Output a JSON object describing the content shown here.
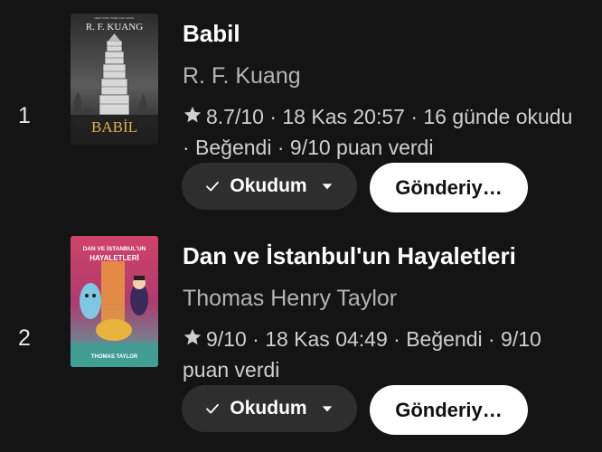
{
  "books": [
    {
      "rank": "1",
      "title": "Babil",
      "author": "R. F. Kuang",
      "meta": "8.7/10 · 18 Kas 20:57 · 16 günde okudu · Beğendi · 9/10 puan verdi",
      "status_label": "Okudum",
      "send_label": "Gönderiy…",
      "cover": {
        "top_text": "R. F. KUANG",
        "title_text": "BABİL",
        "tagline": "NEW YORK TIMES ÇOK SATAN"
      }
    },
    {
      "rank": "2",
      "title": "Dan ve İstanbul'un Hayaletleri",
      "author": "Thomas Henry Taylor",
      "meta": "9/10 · 18 Kas 04:49 · Beğendi · 9/10 puan verdi",
      "status_label": "Okudum",
      "send_label": "Gönderiy…",
      "cover": {
        "title_line1": "DAN VE İSTANBUL'UN",
        "title_line2": "HAYALETLERİ",
        "author_text": "THOMAS TAYLOR"
      }
    }
  ],
  "icons": {
    "star": "star-icon",
    "check": "check-icon",
    "caret": "caret-down-icon"
  },
  "colors": {
    "background": "#141414",
    "button_dark": "#2e2e2e",
    "button_light": "#ffffff",
    "author_gray": "#b4b4b4"
  }
}
